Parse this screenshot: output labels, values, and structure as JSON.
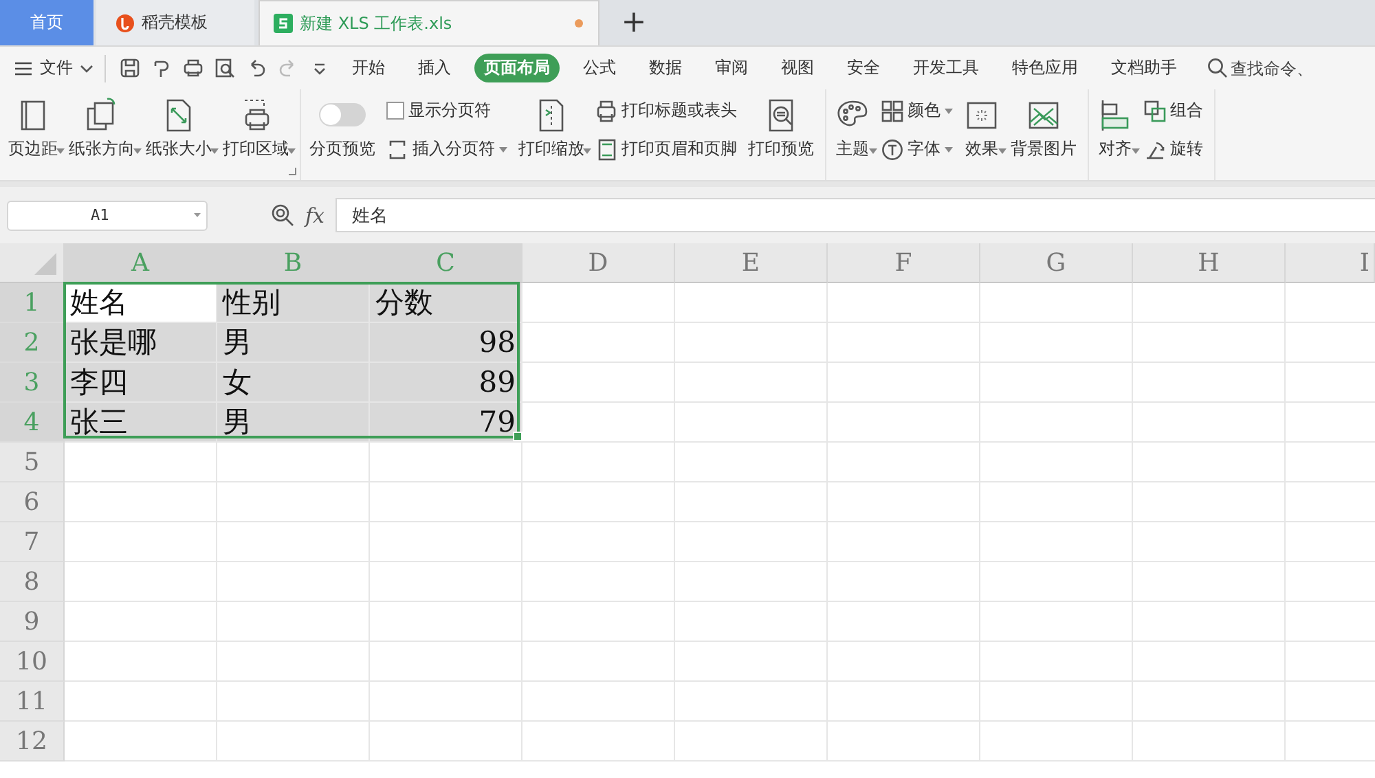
{
  "tabs": [
    {
      "label": "首页",
      "kind": "home",
      "selected": false,
      "modified": false
    },
    {
      "label": "稻壳模板",
      "kind": "template",
      "selected": false,
      "modified": false
    },
    {
      "label": "新建 XLS 工作表.xls",
      "kind": "sheet",
      "selected": true,
      "modified": true
    }
  ],
  "new_tab": "+",
  "menu": {
    "file": "文件",
    "tabs": [
      {
        "label": "开始",
        "selected": false
      },
      {
        "label": "插入",
        "selected": false
      },
      {
        "label": "页面布局",
        "selected": true
      },
      {
        "label": "公式",
        "selected": false
      },
      {
        "label": "数据",
        "selected": false
      },
      {
        "label": "审阅",
        "selected": false
      },
      {
        "label": "视图",
        "selected": false
      },
      {
        "label": "安全",
        "selected": false
      },
      {
        "label": "开发工具",
        "selected": false
      },
      {
        "label": "特色应用",
        "selected": false
      },
      {
        "label": "文档助手",
        "selected": false
      }
    ],
    "search_placeholder": "查找命令、"
  },
  "ribbon": {
    "groups": [
      {
        "launcher": true,
        "items": [
          {
            "kind": "large",
            "label": "页边距",
            "dropdown": true
          },
          {
            "kind": "large",
            "label": "纸张方向",
            "dropdown": true
          },
          {
            "kind": "large",
            "label": "纸张大小",
            "dropdown": true
          },
          {
            "kind": "large",
            "label": "打印区域",
            "dropdown": true
          }
        ]
      },
      {
        "items": [
          {
            "kind": "toggle",
            "label": "分页预览",
            "on": false
          },
          {
            "kind": "stack",
            "rows": [
              {
                "kind": "checkbox",
                "label": "显示分页符",
                "checked": false
              },
              {
                "kind": "small",
                "label": "插入分页符",
                "dropdown": true
              }
            ]
          },
          {
            "kind": "large",
            "label": "打印缩放",
            "dropdown": true
          },
          {
            "kind": "stack",
            "rows": [
              {
                "kind": "small",
                "label": "打印标题或表头",
                "dropdown": false
              },
              {
                "kind": "small",
                "label": "打印页眉和页脚",
                "dropdown": false
              }
            ]
          },
          {
            "kind": "large",
            "label": "打印预览",
            "dropdown": false
          }
        ]
      },
      {
        "items": [
          {
            "kind": "large",
            "label": "主题",
            "dropdown": true
          },
          {
            "kind": "stack",
            "rows": [
              {
                "kind": "small",
                "label": "颜色",
                "dropdown": true
              },
              {
                "kind": "small",
                "label": "字体",
                "dropdown": true
              }
            ]
          },
          {
            "kind": "large",
            "label": "效果",
            "dropdown": true
          },
          {
            "kind": "large",
            "label": "背景图片",
            "dropdown": false
          }
        ]
      },
      {
        "items": [
          {
            "kind": "large",
            "label": "对齐",
            "dropdown": true
          },
          {
            "kind": "stack",
            "rows": [
              {
                "kind": "small",
                "label": "组合",
                "dropdown": false
              },
              {
                "kind": "small",
                "label": "旋转",
                "dropdown": false
              }
            ]
          }
        ]
      }
    ]
  },
  "formula_bar": {
    "name_box": "A1",
    "fx": "fx",
    "formula": "姓名"
  },
  "sheet": {
    "columns": [
      {
        "label": "A",
        "selected": true
      },
      {
        "label": "B",
        "selected": true
      },
      {
        "label": "C",
        "selected": true
      },
      {
        "label": "D",
        "selected": false
      },
      {
        "label": "E",
        "selected": false
      },
      {
        "label": "F",
        "selected": false
      },
      {
        "label": "G",
        "selected": false
      },
      {
        "label": "H",
        "selected": false
      },
      {
        "label": "I",
        "selected": false
      }
    ],
    "rows": [
      {
        "header": "1",
        "selected": true,
        "cells": [
          {
            "text": "姓名",
            "kind": "text",
            "selected": true,
            "active": true
          },
          {
            "text": "性别",
            "kind": "text",
            "selected": true,
            "active": false
          },
          {
            "text": "分数",
            "kind": "text",
            "selected": true,
            "active": false
          }
        ]
      },
      {
        "header": "2",
        "selected": true,
        "cells": [
          {
            "text": "张是哪",
            "kind": "text",
            "selected": true,
            "active": false
          },
          {
            "text": "男",
            "kind": "text",
            "selected": true,
            "active": false
          },
          {
            "text": "98",
            "kind": "number",
            "selected": true,
            "active": false
          }
        ]
      },
      {
        "header": "3",
        "selected": true,
        "cells": [
          {
            "text": "李四",
            "kind": "text",
            "selected": true,
            "active": false
          },
          {
            "text": "女",
            "kind": "text",
            "selected": true,
            "active": false
          },
          {
            "text": "89",
            "kind": "number",
            "selected": true,
            "active": false
          }
        ]
      },
      {
        "header": "4",
        "selected": true,
        "cells": [
          {
            "text": "张三",
            "kind": "text",
            "selected": true,
            "active": false
          },
          {
            "text": "男",
            "kind": "text",
            "selected": true,
            "active": false
          },
          {
            "text": "79",
            "kind": "number",
            "selected": true,
            "active": false
          }
        ]
      },
      {
        "header": "5",
        "selected": false,
        "cells": []
      },
      {
        "header": "6",
        "selected": false,
        "cells": []
      },
      {
        "header": "7",
        "selected": false,
        "cells": []
      },
      {
        "header": "8",
        "selected": false,
        "cells": []
      },
      {
        "header": "9",
        "selected": false,
        "cells": []
      },
      {
        "header": "10",
        "selected": false,
        "cells": []
      },
      {
        "header": "11",
        "selected": false,
        "cells": []
      },
      {
        "header": "12",
        "selected": false,
        "cells": []
      }
    ]
  }
}
